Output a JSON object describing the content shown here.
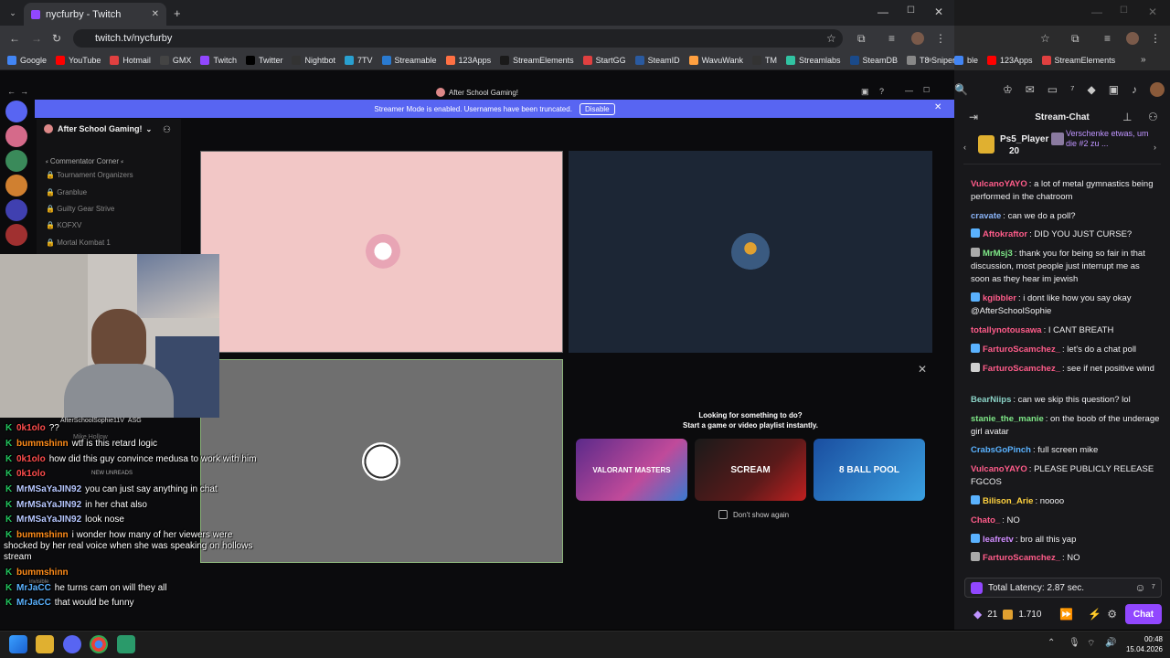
{
  "browser": {
    "tab_title": "nycfurby - Twitch",
    "url": "twitch.tv/nycfurby",
    "bookmarks": [
      "Google",
      "YouTube",
      "Hotmail",
      "GMX",
      "Twitch",
      "Twitter",
      "Nightbot",
      "7TV",
      "Streamable",
      "123Apps",
      "StreamElements",
      "StartGG",
      "SteamID",
      "WavuWank",
      "TM",
      "Streamlabs",
      "SteamDB",
      "T8 Sniper"
    ],
    "bookmarks_right": [
      "ble",
      "123Apps",
      "StreamElements"
    ]
  },
  "discord": {
    "window_title": "After School Gaming!",
    "banner_text": "Streamer Mode is enabled. Usernames have been truncated.",
    "banner_button": "Disable",
    "server_name": "After School Gaming!",
    "channels": [
      "Commentator Corner",
      "Tournament Organizers",
      "Granblue",
      "Guilty Gear Strive",
      "KOFXV",
      "Mortal Kombat 1"
    ],
    "activity": {
      "title": "Looking for something to do?",
      "subtitle": "Start a game or video playlist instantly.",
      "games": [
        "VALORANT MASTERS",
        "SCREAM",
        "8 BALL POOL"
      ],
      "dont_show": "Don't show again"
    },
    "voice_user": "AfterSchoolSophie11V",
    "voice_tag": "ASG",
    "leftover": [
      "Mike Hollow",
      "NEW UNREADS",
      "invisible"
    ]
  },
  "overlay_chat": [
    {
      "user": "0k1olo",
      "text": "??",
      "color": "#ff4d4d"
    },
    {
      "user": "bummshinn",
      "text": "wtf is this retard logic",
      "color": "#ff8c1a"
    },
    {
      "user": "0k1olo",
      "text": "how did this guy convince medusa to work with him",
      "color": "#ff4d4d"
    },
    {
      "user": "0k1olo",
      "text": "",
      "color": "#ff4d4d"
    },
    {
      "user": "MrMSaYaJIN92",
      "text": "you can just say anything in chat",
      "color": "#b7c7ff"
    },
    {
      "user": "MrMSaYaJIN92",
      "text": "in her chat also",
      "color": "#b7c7ff"
    },
    {
      "user": "MrMSaYaJIN92",
      "text": "look nose",
      "color": "#b7c7ff"
    },
    {
      "user": "bummshinn",
      "text": "i wonder how many of her viewers were",
      "color": "#ff8c1a"
    },
    {
      "user": "",
      "text": "shocked by her real voice when she was speaking on hollows",
      "color": "#fff"
    },
    {
      "user": "",
      "text": "stream",
      "color": "#fff"
    },
    {
      "user": "bummshinn",
      "text": "",
      "color": "#ff8c1a"
    },
    {
      "user": "MrJaCC",
      "text": "he turns cam on will they all",
      "color": "#5ab2ff"
    },
    {
      "user": "MrJaCC",
      "text": "that would be funny",
      "color": "#5ab2ff"
    }
  ],
  "twitch_chat": {
    "header": "Stream-Chat",
    "pinned_user": "Ps5_Player",
    "pinned_count": "20",
    "pinned_text": "Verschenke etwas, um die #2 zu ...",
    "messages": [
      {
        "user": "VulcanoYAYO",
        "color": "#ff5c8a",
        "text": "a lot of metal gymnastics being performed in the chatroom"
      },
      {
        "user": "cravate",
        "color": "#8ab4f8",
        "text": "can we do a poll?"
      },
      {
        "user": "Aftokraftor",
        "color": "#ff5c8a",
        "text": "DID YOU JUST CURSE?"
      },
      {
        "user": "MrMsj3",
        "color": "#7ee787",
        "text": "thank you for being so fair in that discussion, most people just interrupt me as soon as they hear im jewish"
      },
      {
        "user": "kgibbler",
        "color": "#ff5c8a",
        "text": "i dont like how you say okay @AfterSchoolSophie"
      },
      {
        "user": "totallynotousawa",
        "color": "#ff5c8a",
        "text": "I CANT BREATH"
      },
      {
        "user": "FarturoScamchez_",
        "color": "#ff5c8a",
        "text": "let's do a chat poll"
      },
      {
        "user": "FarturoScamchez_",
        "color": "#ff5c8a",
        "text": "see if net positive wind"
      },
      {
        "user": "BearNiips",
        "color": "#8bd3c7",
        "text": "can we skip this question? lol"
      },
      {
        "user": "stanie_the_manie",
        "color": "#7ee787",
        "text": "on the boob of the underage girl avatar"
      },
      {
        "user": "CrabsGoPinch",
        "color": "#5ab2ff",
        "text": "full screen mike"
      },
      {
        "user": "VulcanoYAYO",
        "color": "#ff5c8a",
        "text": "PLEASE PUBLICLY RELEASE FGCOS"
      },
      {
        "user": "Bilison_Arie",
        "color": "#ffd23f",
        "text": "noooo"
      },
      {
        "user": "Chato_",
        "color": "#ff5c8a",
        "text": "NO"
      },
      {
        "user": "leafretv",
        "color": "#d08cff",
        "text": "bro all this yap"
      },
      {
        "user": "FarturoScamchez_",
        "color": "#ff5c8a",
        "text": "NO"
      }
    ],
    "latency": "Total Latency: 2.87 sec.",
    "viewers": "21",
    "points": "1.710",
    "chat_button": "Chat"
  },
  "taskbar": {
    "time": "00:48",
    "date": "15.04.2026"
  },
  "colors": {
    "twitch_purple": "#9147ff",
    "discord_blurple": "#5865f2"
  }
}
